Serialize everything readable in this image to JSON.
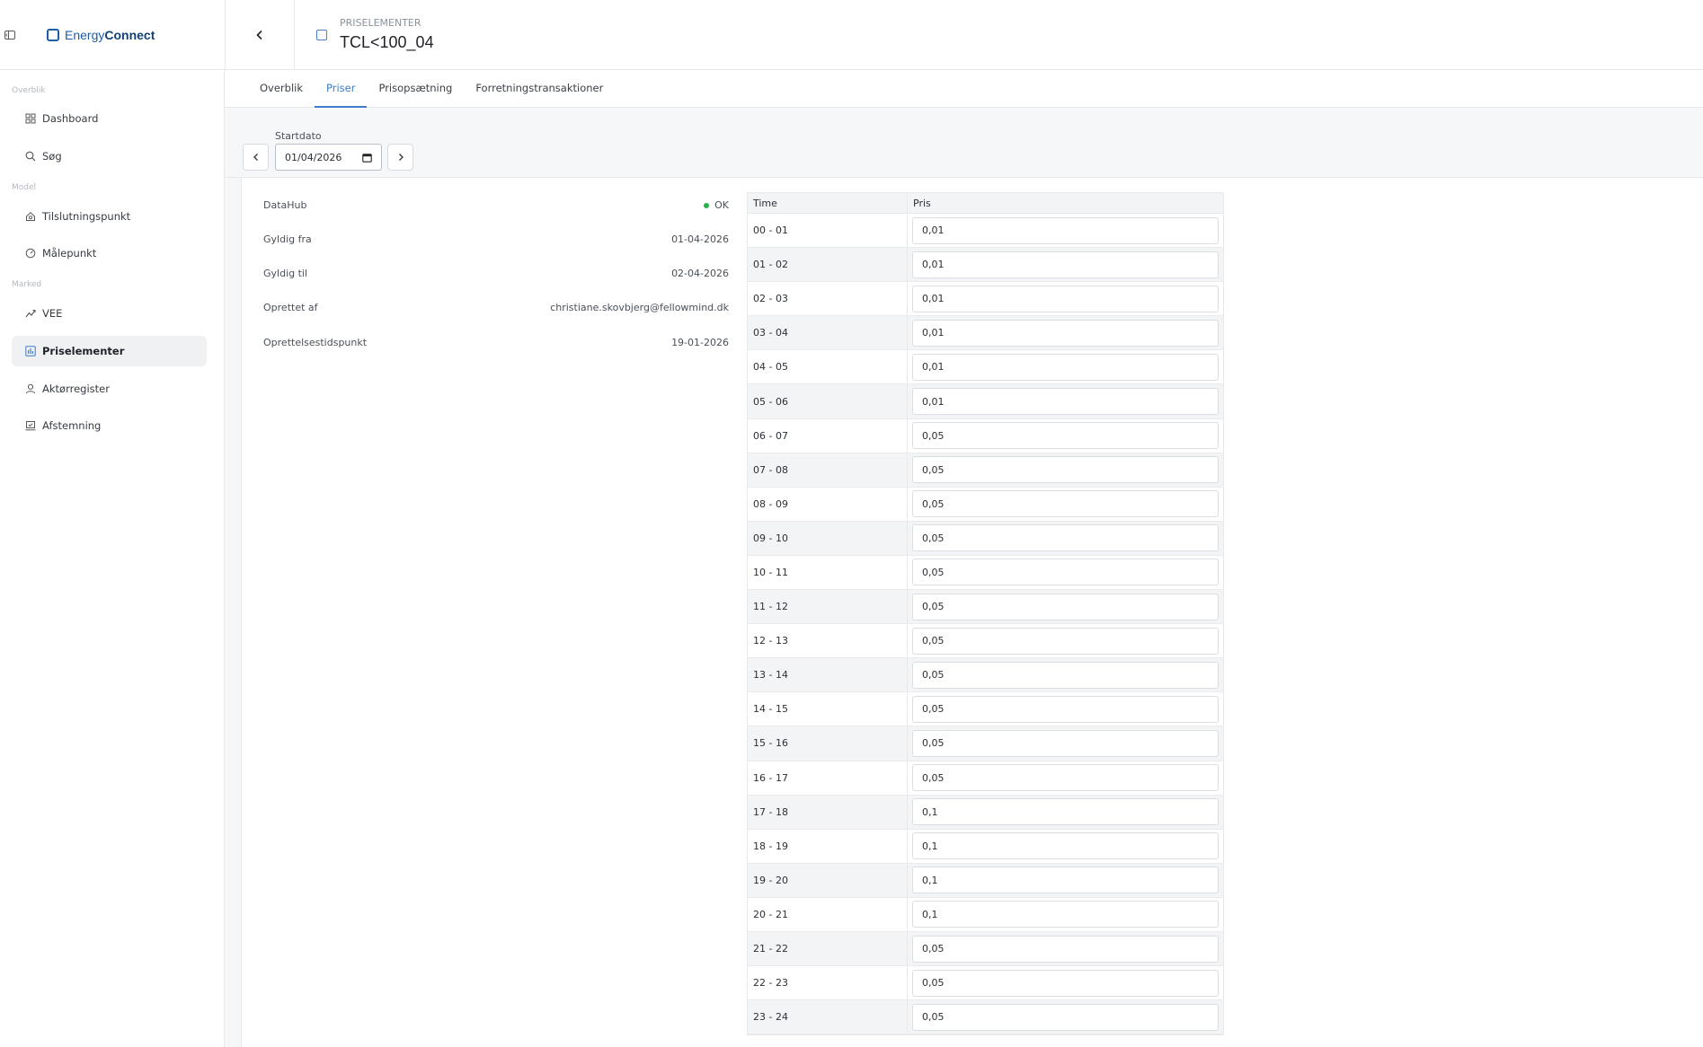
{
  "brand": {
    "name_part1": "Energy",
    "name_part2": "Connect"
  },
  "header": {
    "kicker": "PRISELEMENTER",
    "title": "TCL<100_04"
  },
  "sidebar": {
    "sections": [
      {
        "label": "Overblik",
        "items": [
          {
            "label": "Dashboard",
            "icon": "grid-icon"
          },
          {
            "label": "Søg",
            "icon": "search-icon"
          }
        ]
      },
      {
        "label": "Model",
        "items": [
          {
            "label": "Tilslutningspunkt",
            "icon": "house-icon"
          },
          {
            "label": "Målepunkt",
            "icon": "gauge-icon"
          }
        ]
      },
      {
        "label": "Marked",
        "items": [
          {
            "label": "VEE",
            "icon": "trend-icon"
          },
          {
            "label": "Priselementer",
            "icon": "chart-icon",
            "active": true
          },
          {
            "label": "Aktørregister",
            "icon": "user-icon"
          },
          {
            "label": "Afstemning",
            "icon": "scale-icon"
          }
        ]
      }
    ]
  },
  "tabs": [
    {
      "label": "Overblik"
    },
    {
      "label": "Priser",
      "active": true
    },
    {
      "label": "Prisopsætning"
    },
    {
      "label": "Forretningstransaktioner"
    }
  ],
  "date": {
    "label": "Startdato",
    "value": "01/04/2026"
  },
  "info": [
    {
      "label": "DataHub",
      "value": "OK",
      "status": true
    },
    {
      "label": "Gyldig fra",
      "value": "01-04-2026"
    },
    {
      "label": "Gyldig til",
      "value": "02-04-2026"
    },
    {
      "label": "Oprettet af",
      "value": "christiane.skovbjerg@fellowmind.dk"
    },
    {
      "label": "Oprettelsestidspunkt",
      "value": "19-01-2026"
    }
  ],
  "table": {
    "headers": [
      "Time",
      "Pris"
    ],
    "rows": [
      {
        "time": "00 - 01",
        "price": "0,01"
      },
      {
        "time": "01 - 02",
        "price": "0,01"
      },
      {
        "time": "02 - 03",
        "price": "0,01"
      },
      {
        "time": "03 - 04",
        "price": "0,01"
      },
      {
        "time": "04 - 05",
        "price": "0,01"
      },
      {
        "time": "05 - 06",
        "price": "0,01"
      },
      {
        "time": "06 - 07",
        "price": "0,05"
      },
      {
        "time": "07 - 08",
        "price": "0,05"
      },
      {
        "time": "08 - 09",
        "price": "0,05"
      },
      {
        "time": "09 - 10",
        "price": "0,05"
      },
      {
        "time": "10 - 11",
        "price": "0,05"
      },
      {
        "time": "11 - 12",
        "price": "0,05"
      },
      {
        "time": "12 - 13",
        "price": "0,05"
      },
      {
        "time": "13 - 14",
        "price": "0,05"
      },
      {
        "time": "14 - 15",
        "price": "0,05"
      },
      {
        "time": "15 - 16",
        "price": "0,05"
      },
      {
        "time": "16 - 17",
        "price": "0,05"
      },
      {
        "time": "17 - 18",
        "price": "0,1"
      },
      {
        "time": "18 - 19",
        "price": "0,1"
      },
      {
        "time": "19 - 20",
        "price": "0,1"
      },
      {
        "time": "20 - 21",
        "price": "0,1"
      },
      {
        "time": "21 - 22",
        "price": "0,05"
      },
      {
        "time": "22 - 23",
        "price": "0,05"
      },
      {
        "time": "23 - 24",
        "price": "0,05"
      }
    ]
  },
  "colors": {
    "accent": "#3d7cc9",
    "brand": "#1d5ea8",
    "ok": "#27b34a"
  }
}
